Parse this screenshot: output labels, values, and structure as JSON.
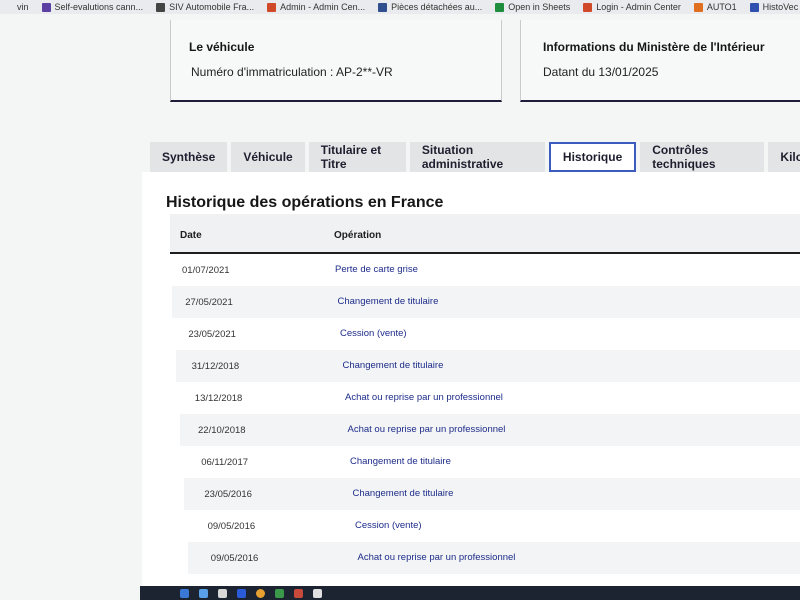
{
  "bookmarks": [
    {
      "label": "vin",
      "color": "#e9ebee"
    },
    {
      "label": "Self-evalutions cann...",
      "color": "#5b3fa3"
    },
    {
      "label": "SIV Automobile Fra...",
      "color": "#444444"
    },
    {
      "label": "Admin - Admin Cen...",
      "color": "#d04a2a"
    },
    {
      "label": "Pièces détachées au...",
      "color": "#2f4f8f"
    },
    {
      "label": "Open in Sheets",
      "color": "#1e8e3e"
    },
    {
      "label": "Login - Admin Center",
      "color": "#d04a2a"
    },
    {
      "label": "AUTO1",
      "color": "#e07020"
    },
    {
      "label": "HistoVec - Accueil",
      "color": "#3050b0"
    }
  ],
  "vehicle_card": {
    "title": "Le véhicule",
    "text": "Numéro d'immatriculation : AP-2**-VR"
  },
  "ministry_card": {
    "title": "Informations du Ministère de l'Intérieur",
    "text": "Datant du 13/01/2025"
  },
  "tabs": [
    {
      "label": "Synthèse",
      "active": false
    },
    {
      "label": "Véhicule",
      "active": false
    },
    {
      "label": "Titulaire et Titre",
      "active": false
    },
    {
      "label": "Situation administrative",
      "active": false
    },
    {
      "label": "Historique",
      "active": true
    },
    {
      "label": "Contrôles techniques",
      "active": false
    },
    {
      "label": "Kilo",
      "active": false
    }
  ],
  "history": {
    "title": "Historique des opérations en France",
    "columns": {
      "date": "Date",
      "operation": "Opération"
    },
    "rows": [
      {
        "date": "01/07/2021",
        "operation": "Perte de carte grise"
      },
      {
        "date": "27/05/2021",
        "operation": "Changement de titulaire"
      },
      {
        "date": "23/05/2021",
        "operation": "Cession (vente)"
      },
      {
        "date": "31/12/2018",
        "operation": "Changement de titulaire"
      },
      {
        "date": "13/12/2018",
        "operation": "Achat ou reprise par un professionnel"
      },
      {
        "date": "22/10/2018",
        "operation": "Achat ou reprise par un professionnel"
      },
      {
        "date": "06/11/2017",
        "operation": "Changement de titulaire"
      },
      {
        "date": "23/05/2016",
        "operation": "Changement de titulaire"
      },
      {
        "date": "09/05/2016",
        "operation": "Cession (vente)"
      },
      {
        "date": "09/05/2016",
        "operation": "Achat ou reprise par un professionnel"
      }
    ]
  },
  "colors": {
    "link": "#1d2b8a",
    "active_tab_border": "#3b5bbf",
    "taskbar": "#1c2331"
  }
}
